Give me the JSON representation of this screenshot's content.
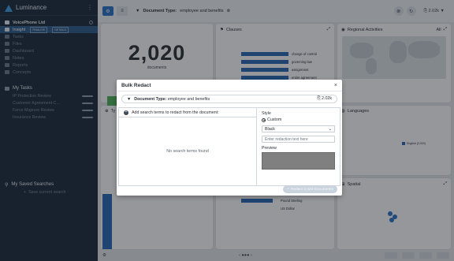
{
  "app": {
    "name": "Luminance"
  },
  "sidebar": {
    "project": "VoicePhone Ltd",
    "items": [
      {
        "label": "Insight",
        "active": true,
        "badges": [
          "FINALISE",
          "DETAILS"
        ]
      },
      {
        "label": "Tasks"
      },
      {
        "label": "Files"
      },
      {
        "label": "Dashboard"
      },
      {
        "label": "Notes"
      },
      {
        "label": "Reports"
      },
      {
        "label": "Concepts"
      }
    ],
    "tasks_title": "My Tasks",
    "tasks": [
      {
        "label": "IP Protection Review"
      },
      {
        "label": "Customer Agreement C..."
      },
      {
        "label": "Force Majeure Review"
      },
      {
        "label": "Insurance Review"
      }
    ],
    "saved_title": "My Saved Searches",
    "save_current": "Save current search"
  },
  "topbar": {
    "filter_label": "Document Type:",
    "filter_value": "employee and benefits",
    "doc_count": "2.02k"
  },
  "dashboard": {
    "doc_count": "2,020",
    "doc_label": "documents",
    "clauses_title": "Clauses",
    "clause_labels": [
      "change of control",
      "governing law",
      "assignment",
      "entire agreement"
    ],
    "regional_title": "Regional Activities",
    "regional_filter": "All",
    "languages_title": "Languages",
    "language_label": "English (2,020)",
    "spatial_title": "Spatial",
    "currencies": [
      "Pound Sterling",
      "US Dollar"
    ],
    "type_title": "Ty"
  },
  "modal": {
    "title": "Bulk Redact",
    "filter_label": "Document Type:",
    "filter_value": "employee and benefits",
    "filter_count": "2.02k",
    "add_terms_label": "Add search terms to redact from the document:",
    "empty_text": "No search terms found",
    "style_label": "Style",
    "style_option": "Custom",
    "color_value": "Black",
    "replacement_placeholder": "Enter redaction text here",
    "preview_label": "Preview",
    "redact_button": "Redact 2,020 Documents",
    "preview_color": "#808080"
  }
}
